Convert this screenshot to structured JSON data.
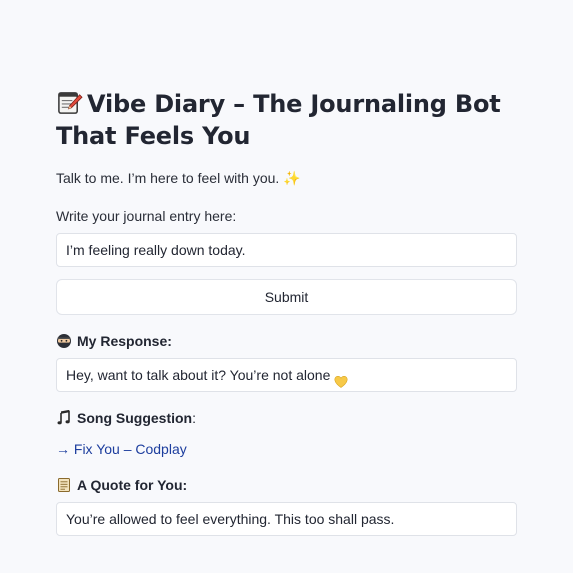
{
  "app": {
    "title_icon": "memo-emoji",
    "title": "Vibe Diary – The Journaling Bot That Feels You",
    "subtitle": "Talk to me. I’m here to feel with you. ✨",
    "sparkle_icon": "sparkles-emoji"
  },
  "entry": {
    "label": "Write your journal entry here:",
    "value": "I’m feeling really down today."
  },
  "submit": {
    "label": "Submit"
  },
  "response": {
    "icon": "ninja-emoji",
    "heading": "My Response:",
    "text": "Hey, want to talk about it? You’re not alone",
    "heart_icon": "yellow-heart-emoji"
  },
  "song": {
    "icon": "music-notes-emoji",
    "heading": "Song Suggestion",
    "colon": ":",
    "link_text": "→ Fix You – Codplay"
  },
  "quote": {
    "icon": "scroll-emoji",
    "heading": "A Quote for You:",
    "text": "You’re allowed to feel everything. This too shall pass."
  },
  "colors": {
    "background": "#f8f9fc",
    "link": "#1d3e9e",
    "heart": "#f7c948"
  }
}
